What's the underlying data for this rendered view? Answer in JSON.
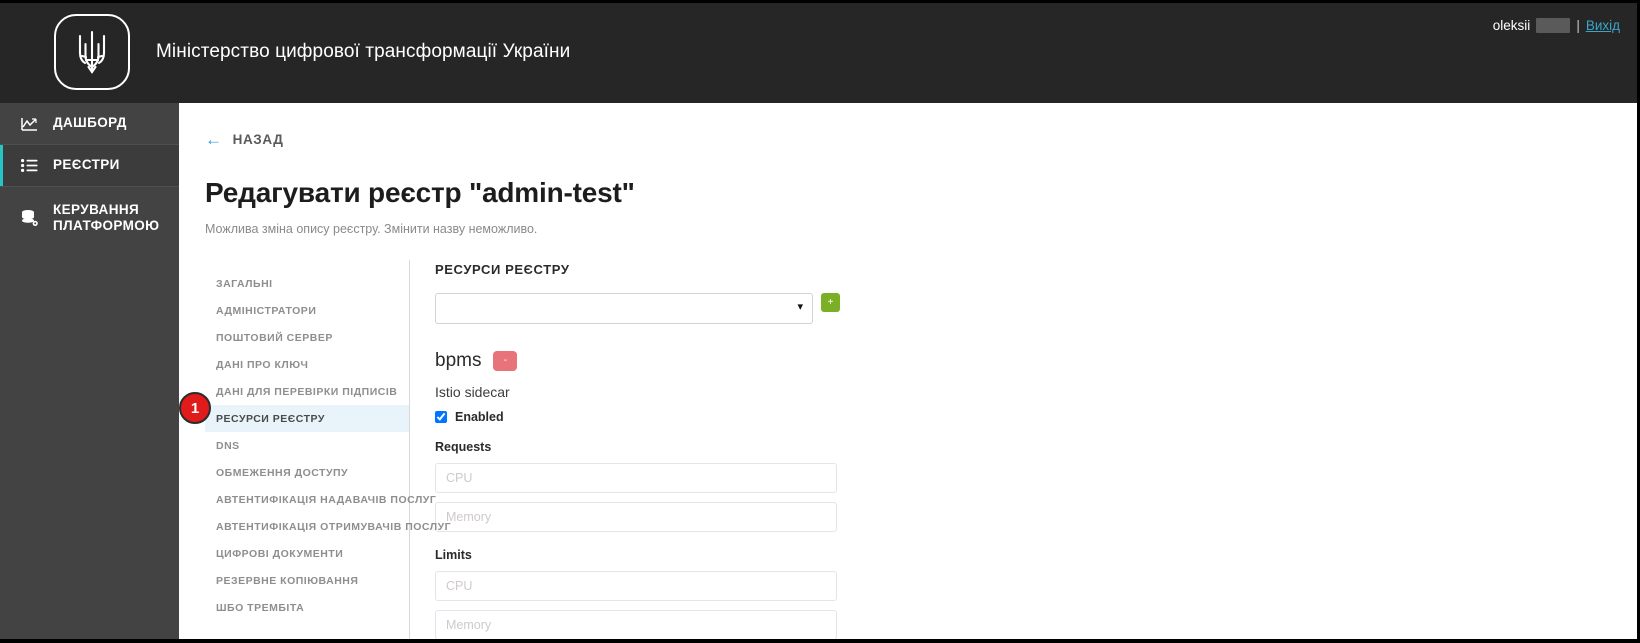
{
  "header": {
    "emblem_icon": "ukraine-trident-icon",
    "brand_title": "Міністерство цифрової трансформації України",
    "account": {
      "username": "oleksii",
      "separator": "|",
      "logout_label": "Вихід"
    }
  },
  "sidebar": {
    "items": [
      {
        "label": "ДАШБОРД",
        "icon": "chart-icon",
        "active": false
      },
      {
        "label": "РЕЄСТРИ",
        "icon": "list-icon",
        "active": true
      },
      {
        "label": "КЕРУВАННЯ ПЛАТФОРМОЮ",
        "icon": "database-gear-icon",
        "active": false
      }
    ]
  },
  "page": {
    "back_label": "НАЗАД",
    "back_icon": "arrow-left-icon",
    "title": "Редагувати реєстр \"admin-test\"",
    "subtitle": "Можлива зміна опису реєстру. Змінити назву неможливо."
  },
  "tabs": [
    {
      "label": "ЗАГАЛЬНІ",
      "active": false
    },
    {
      "label": "АДМІНІСТРАТОРИ",
      "active": false
    },
    {
      "label": "ПОШТОВИЙ СЕРВЕР",
      "active": false
    },
    {
      "label": "ДАНІ ПРО КЛЮЧ",
      "active": false
    },
    {
      "label": "ДАНІ ДЛЯ ПЕРЕВІРКИ ПІДПИСІВ",
      "active": false
    },
    {
      "label": "РЕСУРСИ РЕЄСТРУ",
      "active": true
    },
    {
      "label": "DNS",
      "active": false
    },
    {
      "label": "ОБМЕЖЕННЯ ДОСТУПУ",
      "active": false
    },
    {
      "label": "АВТЕНТИФІКАЦІЯ НАДАВАЧІВ ПОСЛУГ",
      "active": false
    },
    {
      "label": "АВТЕНТИФІКАЦІЯ ОТРИМУВАЧІВ ПОСЛУГ",
      "active": false
    },
    {
      "label": "ЦИФРОВІ ДОКУМЕНТИ",
      "active": false
    },
    {
      "label": "РЕЗЕРВНЕ КОПІЮВАННЯ",
      "active": false
    },
    {
      "label": "ШБО ТРЕМБІТА",
      "active": false
    }
  ],
  "form": {
    "section_title": "РЕСУРСИ РЕЄСТРУ",
    "resource_select": {
      "value": "",
      "options": [
        ""
      ]
    },
    "add_button_label": "+",
    "resource": {
      "name": "bpms",
      "remove_button_label": "-",
      "istio_label": "Istio sidecar",
      "enabled_label": "Enabled",
      "enabled_checked": true,
      "requests_label": "Requests",
      "requests_cpu_placeholder": "CPU",
      "requests_cpu_value": "",
      "requests_memory_placeholder": "Memory",
      "requests_memory_value": "",
      "limits_label": "Limits",
      "limits_cpu_placeholder": "CPU",
      "limits_cpu_value": "",
      "limits_memory_placeholder": "Memory",
      "limits_memory_value": ""
    }
  },
  "annotation": {
    "step_number": "1"
  },
  "colors": {
    "header_bg": "#262626",
    "sidebar_bg": "#434343",
    "active_accent": "#27c6c6",
    "link_blue": "#3aa6c7",
    "add_green": "#7bb026",
    "remove_red": "#e8737a",
    "badge_red": "#e01b1b",
    "tab_active_bg": "#e9f3fa"
  }
}
